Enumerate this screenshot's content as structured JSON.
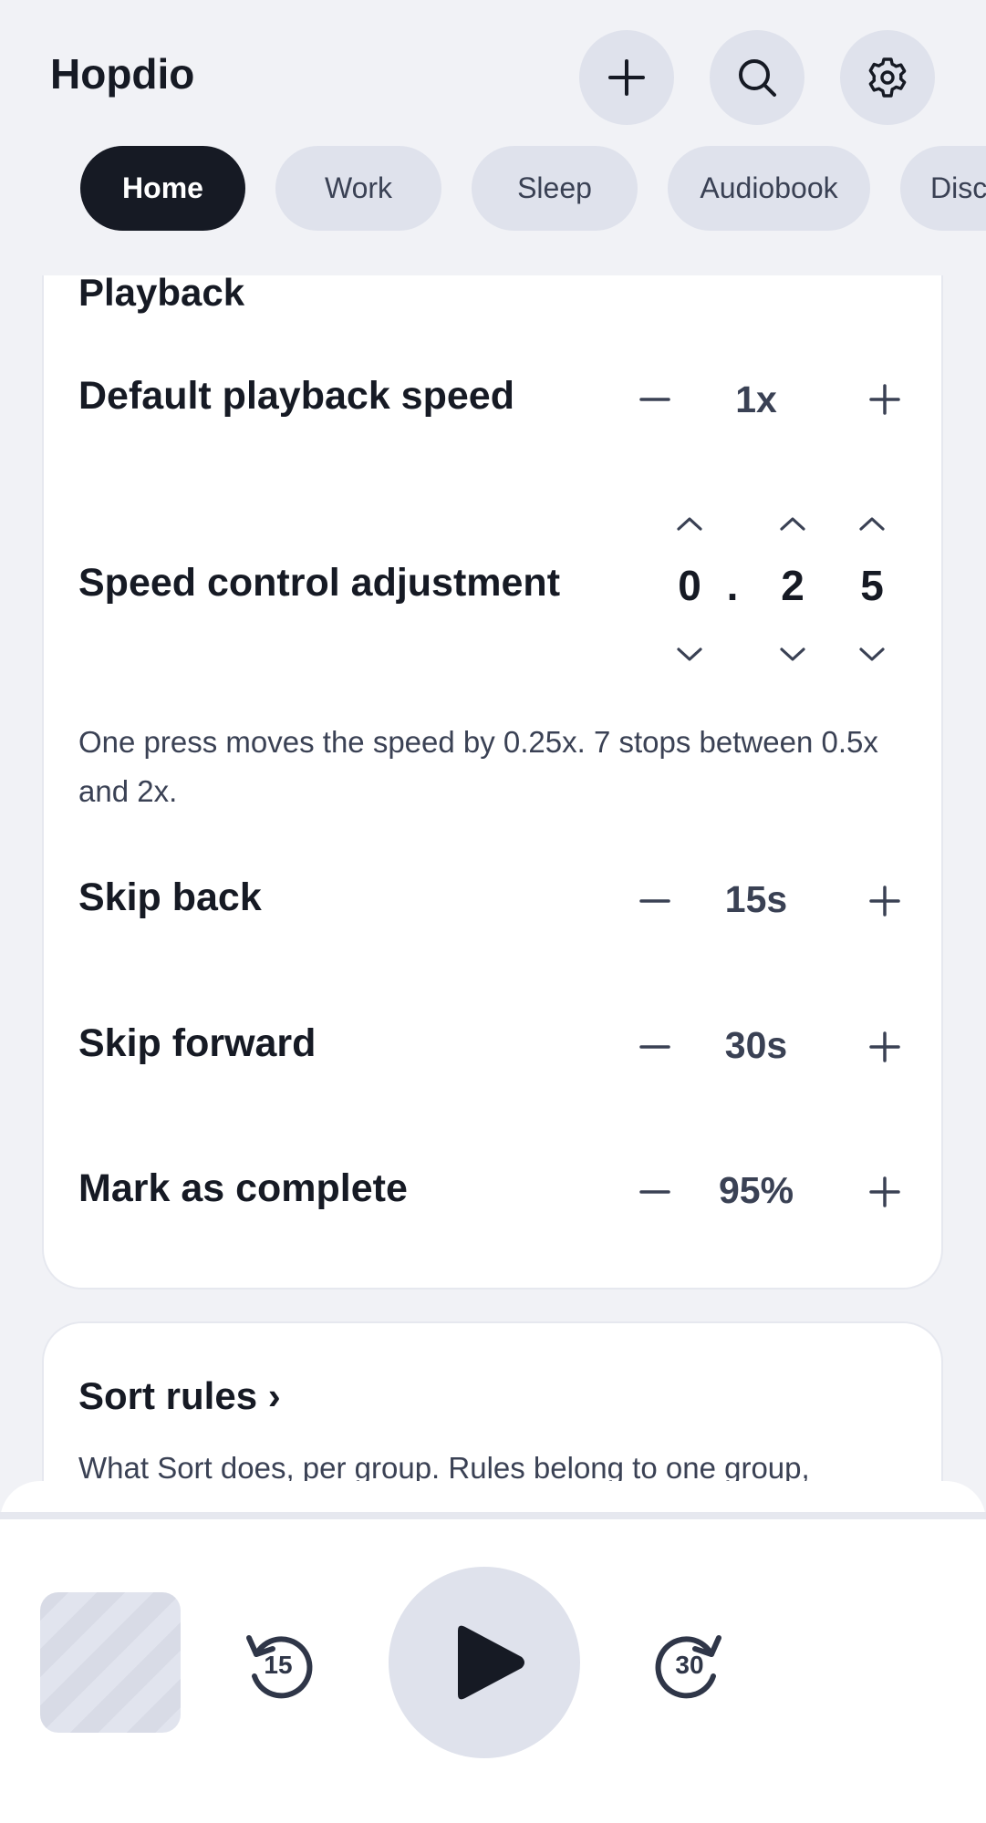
{
  "app": {
    "title": "Hopdio"
  },
  "header_buttons": {
    "add": "plus-icon",
    "search": "search-icon",
    "settings": "gear-icon"
  },
  "tabs": [
    {
      "label": "Home",
      "active": true
    },
    {
      "label": "Work",
      "active": false
    },
    {
      "label": "Sleep",
      "active": false
    },
    {
      "label": "Audiobook",
      "active": false
    },
    {
      "label": "Disc",
      "active": false
    }
  ],
  "playback": {
    "section_title": "Playback",
    "default_speed": {
      "label": "Default playback speed",
      "value": "1x"
    },
    "speed_adjust": {
      "label": "Speed control adjustment",
      "digits": [
        "0",
        "2",
        "5"
      ],
      "separator": ".",
      "description": "One press moves the speed by 0.25x. 7 stops between 0.5x and 2x."
    },
    "skip_back": {
      "label": "Skip back",
      "value": "15s"
    },
    "skip_forward": {
      "label": "Skip forward",
      "value": "30s"
    },
    "mark_complete": {
      "label": "Mark as complete",
      "value": "95%"
    }
  },
  "sort_rules": {
    "title": "Sort rules ›",
    "description": "What Sort does, per group. Rules belong to one group,"
  },
  "player": {
    "skip_back_seconds": "15",
    "skip_forward_seconds": "30"
  },
  "colors": {
    "accent_dark": "#161a24",
    "chip_bg": "#dfe2ec",
    "page_bg": "#f1f2f6"
  }
}
